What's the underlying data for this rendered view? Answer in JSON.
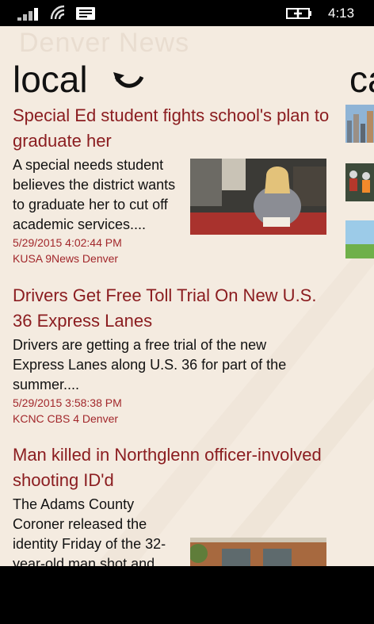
{
  "status_bar": {
    "time": "4:13",
    "icons": [
      "signal-icon",
      "wifi-icon",
      "messages-icon",
      "battery-charging-icon"
    ]
  },
  "app": {
    "brand": "Denver News",
    "section": "local",
    "next_section_peek": "ca",
    "accent_color": "#8b1d20",
    "background_color": "#f4ebe0"
  },
  "articles": [
    {
      "headline": "Special Ed student fights school's plan to graduate her",
      "summary": "A special needs student believes the district wants to graduate her to cut off academic services....",
      "date": "5/29/2015 4:02:44 PM",
      "source": "KUSA 9News Denver",
      "has_photo": true
    },
    {
      "headline": "Drivers Get Free Toll Trial On New U.S. 36 Express Lanes",
      "summary": "Drivers are getting a free trial of the new Express Lanes along U.S. 36 for part of the summer....",
      "date": "5/29/2015 3:58:38 PM",
      "source": "KCNC CBS 4 Denver",
      "has_photo": false
    },
    {
      "headline": "Man killed in Northglenn officer-involved shooting ID'd",
      "summary": "The Adams County Coroner released the identity Friday of the 32-year-old man shot and",
      "date": "",
      "source": "",
      "has_photo": true
    }
  ]
}
